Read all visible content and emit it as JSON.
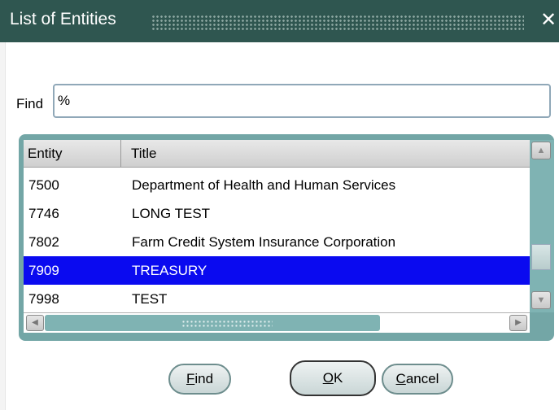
{
  "window": {
    "title": "List of Entities",
    "close_glyph": "✕"
  },
  "find": {
    "label": "Find",
    "value": "%"
  },
  "list": {
    "columns": [
      "Entity",
      "Title"
    ],
    "rows": [
      {
        "entity": "7500",
        "title": "Department of Health and Human Services"
      },
      {
        "entity": "7746",
        "title": "LONG TEST"
      },
      {
        "entity": "7802",
        "title": "Farm Credit System Insurance Corporation"
      },
      {
        "entity": "7909",
        "title": "TREASURY",
        "selected": true
      },
      {
        "entity": "7998",
        "title": "TEST"
      }
    ]
  },
  "buttons": {
    "find_mnemonic": "F",
    "find_rest": "ind",
    "ok_mnemonic": "O",
    "ok_rest": "K",
    "cancel_mnemonic": "C",
    "cancel_rest": "ancel"
  },
  "colors": {
    "titlebar": "#2f5650",
    "frame": "#73a6a6",
    "selection": "#0a0af0"
  },
  "icons": {
    "close": "close-icon",
    "scroll_up": "arrow-up-icon",
    "scroll_down": "arrow-down-icon",
    "scroll_left": "arrow-left-icon",
    "scroll_right": "arrow-right-icon"
  }
}
